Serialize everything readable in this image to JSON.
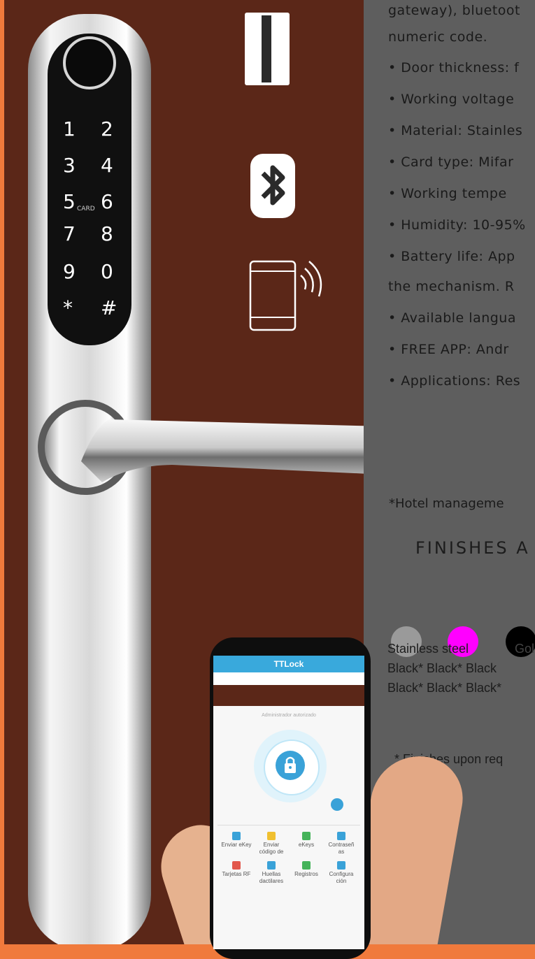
{
  "specs": {
    "line_gateway": "gateway), bluetoot",
    "line_numeric": "numeric code.",
    "door_thickness": "• Door thickness: f",
    "working_voltage": "• Working voltage",
    "material": "• Material: Stainles",
    "card_type": "• Card type: Mifar",
    "working_temp": "• Working tempe",
    "humidity": "• Humidity: 10-95%",
    "battery_life": "• Battery life: App",
    "mechanism": "the mechanism. R",
    "languages": "• Available langua",
    "free_app": "• FREE APP: Andr",
    "applications": "• Applications: Res"
  },
  "hotel_note": "*Hotel manageme",
  "finishes": {
    "title": "FINISHES A",
    "swatches": [
      {
        "color": "#9a9a9a"
      },
      {
        "color": "#ff00ff"
      },
      {
        "color": "#000000"
      }
    ],
    "label_stainless": "Stainless steel",
    "label_gold": "Gol",
    "row2": "Black* Black* Black",
    "row3": "Black* Black* Black*",
    "upon_request": "* Finishes upon req"
  },
  "keypad": {
    "keys": [
      "1",
      "2",
      "3",
      "4",
      "5",
      "6",
      "7",
      "8",
      "9",
      "0",
      "*",
      "#"
    ],
    "card_label": "CARD"
  },
  "phone": {
    "app_title": "TTLock",
    "admin_label": "Administrador autorizado",
    "grid": [
      {
        "label": "Enviar eKey",
        "color": "#3aa2d8"
      },
      {
        "label": "Enviar código de",
        "color": "#f0c030"
      },
      {
        "label": "eKeys",
        "color": "#45b35a"
      },
      {
        "label": "Contraseñ as",
        "color": "#3aa2d8"
      },
      {
        "label": "Tarjetas RF",
        "color": "#e2574c"
      },
      {
        "label": "Huellas dactilares",
        "color": "#3aa2d8"
      },
      {
        "label": "Registros",
        "color": "#45b35a"
      },
      {
        "label": "Configura ción",
        "color": "#3aa2d8"
      }
    ]
  },
  "icons": [
    "card-icon",
    "bluetooth-icon",
    "rfid-card-icon"
  ]
}
